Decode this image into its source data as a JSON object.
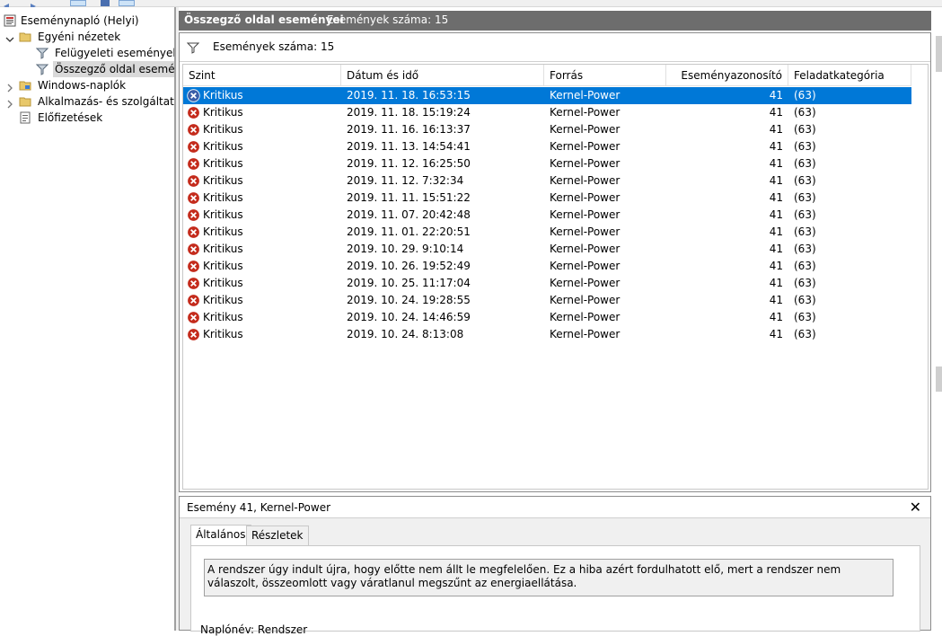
{
  "tree": {
    "root": "Eseménynapló (Helyi)",
    "custom_views": "Egyéni nézetek",
    "admin_events": "Felügyeleti események",
    "summary_events": "Összegző oldal eseménye",
    "windows_logs": "Windows-naplók",
    "apps_services": "Alkalmazás- és szolgáltatásn",
    "subscriptions": "Előfizetések"
  },
  "header": {
    "title": "Összegző oldal eseményei",
    "count": "Események száma: 15"
  },
  "filter": {
    "text": "Események száma: 15"
  },
  "columns": {
    "level": "Szint",
    "datetime": "Dátum és idő",
    "source": "Forrás",
    "event_id": "Eseményazonosító",
    "task_category": "Feladatkategória"
  },
  "rows": [
    {
      "level": "Kritikus",
      "datetime": "2019. 11. 18. 16:53:15",
      "source": "Kernel-Power",
      "event_id": "41",
      "task": "(63)"
    },
    {
      "level": "Kritikus",
      "datetime": "2019. 11. 18. 15:19:24",
      "source": "Kernel-Power",
      "event_id": "41",
      "task": "(63)"
    },
    {
      "level": "Kritikus",
      "datetime": "2019. 11. 16. 16:13:37",
      "source": "Kernel-Power",
      "event_id": "41",
      "task": "(63)"
    },
    {
      "level": "Kritikus",
      "datetime": "2019. 11. 13. 14:54:41",
      "source": "Kernel-Power",
      "event_id": "41",
      "task": "(63)"
    },
    {
      "level": "Kritikus",
      "datetime": "2019. 11. 12. 16:25:50",
      "source": "Kernel-Power",
      "event_id": "41",
      "task": "(63)"
    },
    {
      "level": "Kritikus",
      "datetime": "2019. 11. 12. 7:32:34",
      "source": "Kernel-Power",
      "event_id": "41",
      "task": "(63)"
    },
    {
      "level": "Kritikus",
      "datetime": "2019. 11. 11. 15:51:22",
      "source": "Kernel-Power",
      "event_id": "41",
      "task": "(63)"
    },
    {
      "level": "Kritikus",
      "datetime": "2019. 11. 07. 20:42:48",
      "source": "Kernel-Power",
      "event_id": "41",
      "task": "(63)"
    },
    {
      "level": "Kritikus",
      "datetime": "2019. 11. 01. 22:20:51",
      "source": "Kernel-Power",
      "event_id": "41",
      "task": "(63)"
    },
    {
      "level": "Kritikus",
      "datetime": "2019. 10. 29. 9:10:14",
      "source": "Kernel-Power",
      "event_id": "41",
      "task": "(63)"
    },
    {
      "level": "Kritikus",
      "datetime": "2019. 10. 26. 19:52:49",
      "source": "Kernel-Power",
      "event_id": "41",
      "task": "(63)"
    },
    {
      "level": "Kritikus",
      "datetime": "2019. 10. 25. 11:17:04",
      "source": "Kernel-Power",
      "event_id": "41",
      "task": "(63)"
    },
    {
      "level": "Kritikus",
      "datetime": "2019. 10. 24. 19:28:55",
      "source": "Kernel-Power",
      "event_id": "41",
      "task": "(63)"
    },
    {
      "level": "Kritikus",
      "datetime": "2019. 10. 24. 14:46:59",
      "source": "Kernel-Power",
      "event_id": "41",
      "task": "(63)"
    },
    {
      "level": "Kritikus",
      "datetime": "2019. 10. 24. 8:13:08",
      "source": "Kernel-Power",
      "event_id": "41",
      "task": "(63)"
    }
  ],
  "details": {
    "title": "Esemény 41, Kernel-Power",
    "close_glyph": "✕",
    "tab_general": "Általános",
    "tab_details": "Részletek",
    "description": "A rendszer úgy indult újra, hogy előtte nem állt le megfelelően. Ez a hiba azért fordulhatott elő, mert a rendszer nem válaszolt, összeomlott vagy váratlanul megszűnt az energiaellátása.",
    "cutoff_text": "Naplónév:                   Rendszer"
  },
  "colors": {
    "selection": "#0078d7",
    "header_bg": "#6d6d6d",
    "critical": "#c42b1c"
  }
}
